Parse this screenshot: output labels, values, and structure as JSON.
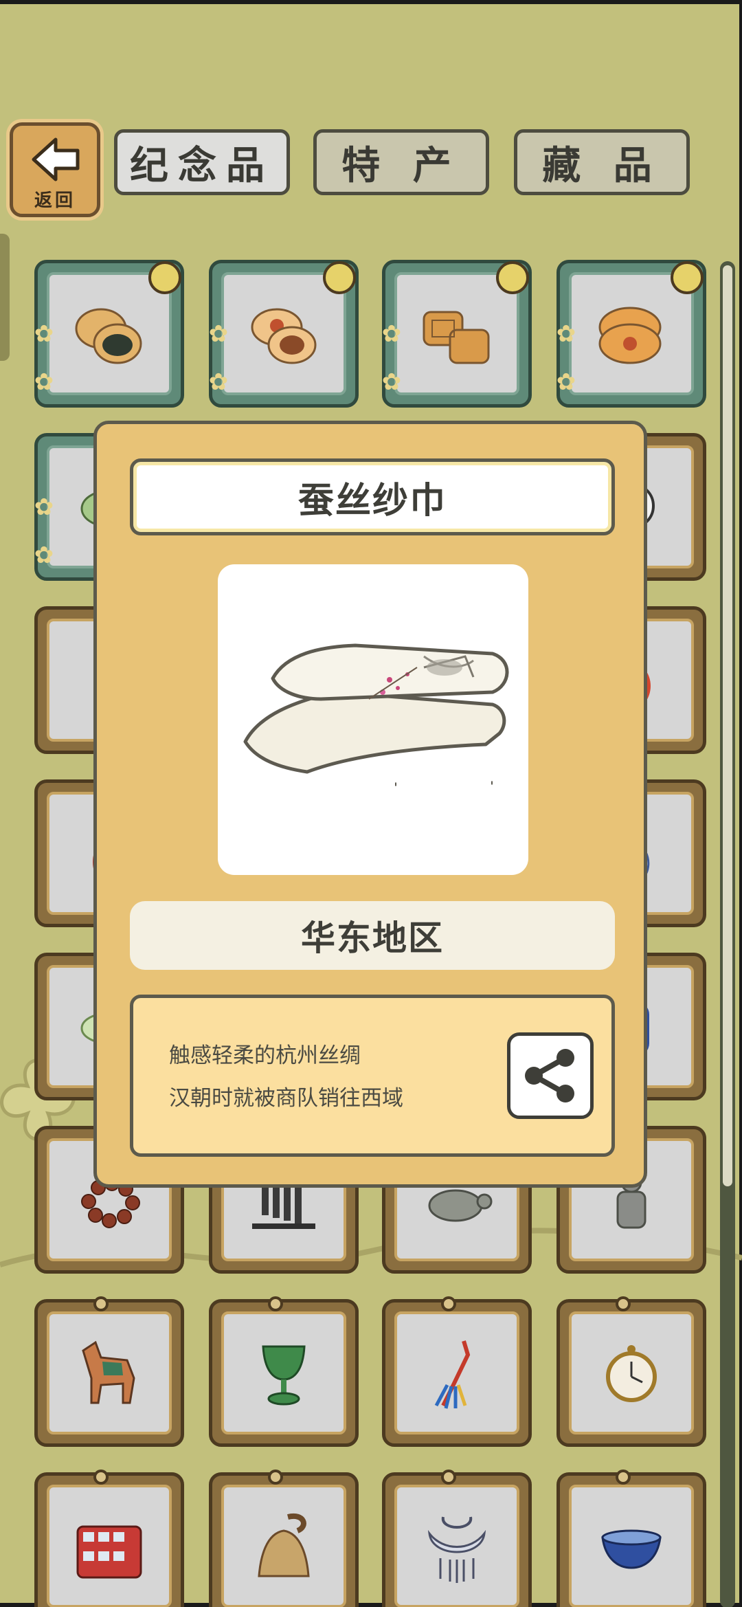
{
  "nav": {
    "back_label": "返回",
    "tabs": [
      {
        "label": "纪念品",
        "selected": true
      },
      {
        "label": "特 产",
        "selected": false
      },
      {
        "label": "藏 品",
        "selected": false
      }
    ]
  },
  "grid": {
    "items": [
      {
        "icon": "pastry-icon"
      },
      {
        "icon": "mooncake-icon"
      },
      {
        "icon": "mooncake-pair-icon"
      },
      {
        "icon": "mooncake-box-icon"
      },
      {
        "icon": "green-cake-icon"
      },
      {
        "icon": "clock-icon"
      },
      {
        "icon": "knot-icon"
      },
      {
        "icon": "rooster-icon"
      },
      {
        "icon": "figurine-icon"
      },
      {
        "icon": "vase-icon"
      },
      {
        "icon": "bowl-icon"
      },
      {
        "icon": "porcelain-icon"
      },
      {
        "icon": "bead-bracelet-icon"
      },
      {
        "icon": "chimes-icon"
      },
      {
        "icon": "turtle-icon"
      },
      {
        "icon": "warrior-statue-icon"
      },
      {
        "icon": "tang-horse-icon"
      },
      {
        "icon": "jade-cup-icon"
      },
      {
        "icon": "tassel-icon"
      },
      {
        "icon": "pocket-watch-icon"
      },
      {
        "icon": "double-decker-bus-icon"
      },
      {
        "icon": "bell-icon"
      },
      {
        "icon": "silver-lock-icon"
      },
      {
        "icon": "tea-bowl-icon"
      }
    ]
  },
  "popup": {
    "item_name": "蚕丝纱巾",
    "item_icon": "silk-scarf-icon",
    "region": "华东地区",
    "description": [
      "触感轻柔的杭州丝绸",
      "汉朝时就被商队销往西域"
    ],
    "share_icon": "share-icon"
  },
  "colors": {
    "background": "#c2c07c",
    "popup_bg": "#e8c377",
    "desc_bg": "#fbdf9f",
    "frame_brown": "#8a6e3f",
    "frame_teal": "#5f8a78"
  }
}
